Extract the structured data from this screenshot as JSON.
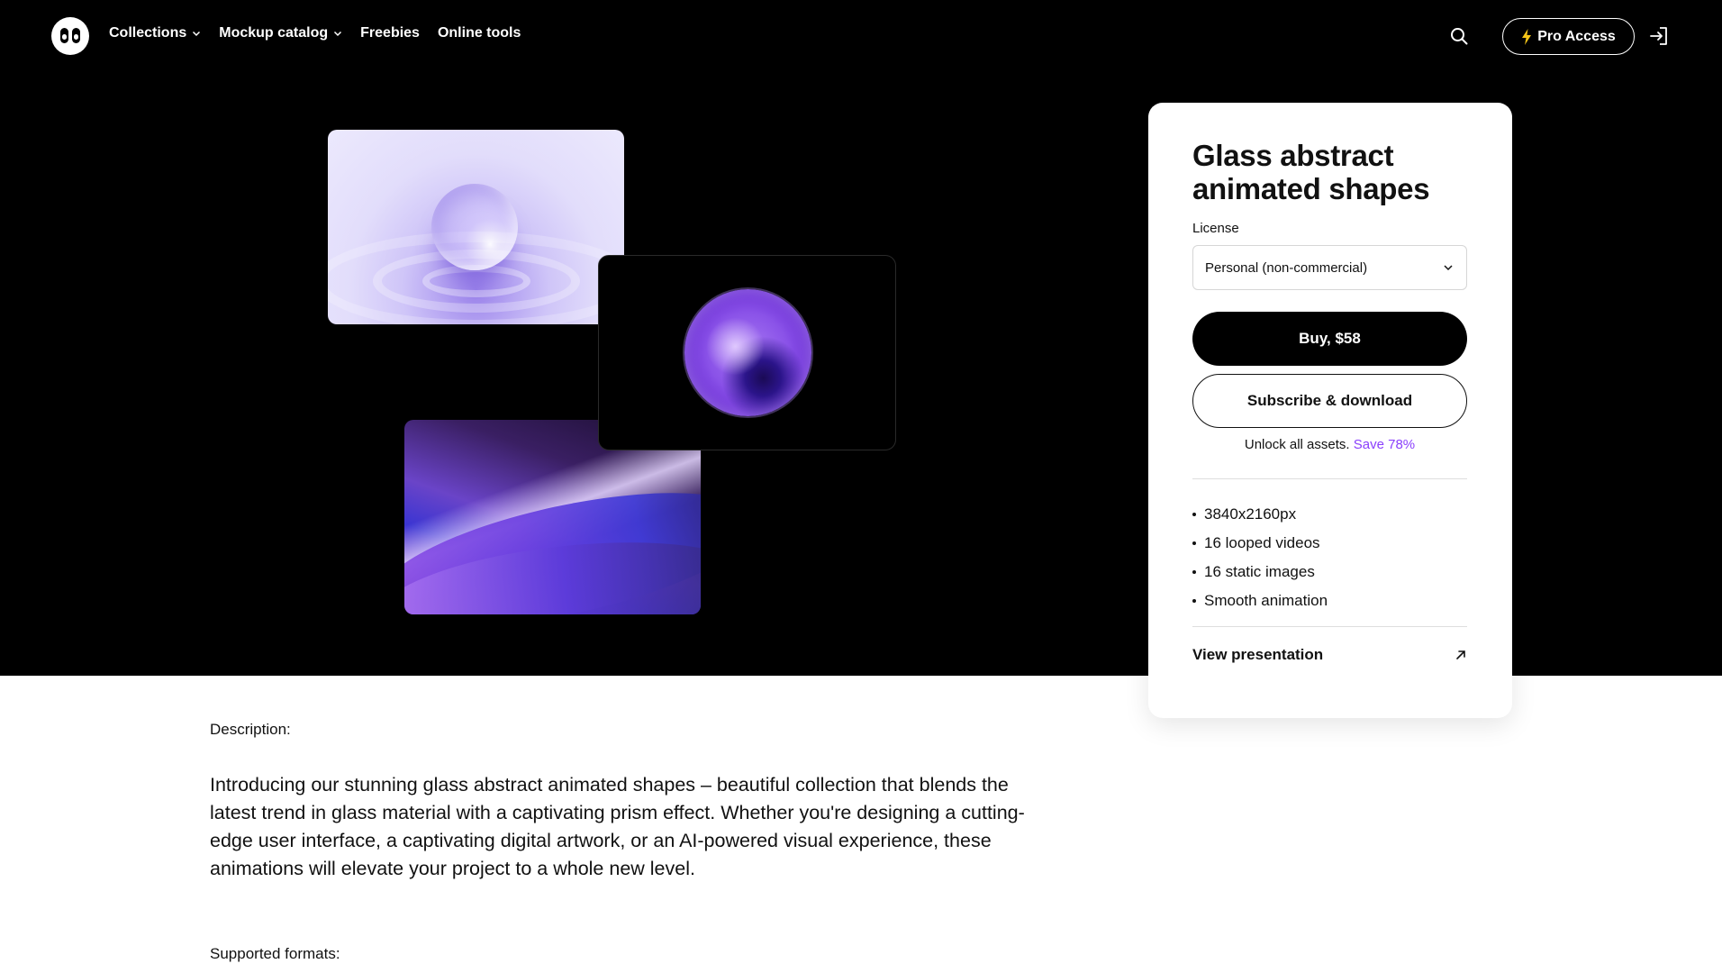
{
  "nav": {
    "links": [
      {
        "label": "Collections",
        "has_dropdown": true
      },
      {
        "label": "Mockup catalog",
        "has_dropdown": true
      },
      {
        "label": "Freebies",
        "has_dropdown": false
      },
      {
        "label": "Online tools",
        "has_dropdown": false
      }
    ],
    "pro_access_label": "Pro Access",
    "icons": {
      "logo": "eyes-logo-icon",
      "search": "search-icon",
      "pro": "lightning-bolt-icon",
      "login": "sign-in-icon"
    }
  },
  "product": {
    "title": "Glass abstract animated shapes",
    "license_label": "License",
    "license_value": "Personal (non-commercial)",
    "buy_label": "Buy, $58",
    "subscribe_label": "Subscribe & download",
    "unlock_text": "Unlock all assets.",
    "save_text": "Save 78%",
    "features": [
      "3840x2160px",
      "16 looped videos",
      "16 static images",
      "Smooth animation"
    ],
    "view_presentation_label": "View presentation"
  },
  "description": {
    "label": "Description:",
    "text": "Introducing our stunning glass abstract animated shapes – beautiful collection that blends the latest trend in glass material with a captivating prism effect. Whether you're designing a cutting-edge user interface, a captivating digital artwork, or an AI-powered visual experience, these animations will elevate your project to a whole new level.",
    "formats_label": "Supported formats:"
  },
  "colors": {
    "hero_background": "#000000",
    "accent": "#8a3ffc",
    "button_dark": "#000000"
  }
}
